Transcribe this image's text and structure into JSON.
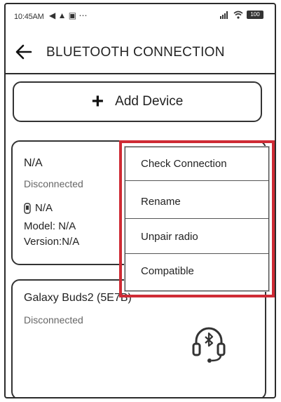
{
  "status_bar": {
    "time": "10:45AM",
    "left_icons": "◀ ▲ ▣ ⋯",
    "battery": "100"
  },
  "header": {
    "title": "BLUETOOTH CONNECTION"
  },
  "add_device": {
    "label": "Add Device"
  },
  "devices": [
    {
      "name": "N/A",
      "status": "Disconnected",
      "device": "N/A",
      "model": "Model: N/A",
      "version": "Version:N/A"
    },
    {
      "name": "Galaxy Buds2 (5E7B)",
      "status": "Disconnected"
    }
  ],
  "context_menu": {
    "items": [
      "Check Connection",
      "Rename",
      "Unpair radio",
      "Compatible"
    ]
  },
  "colors": {
    "highlight": "#cf2b35",
    "border": "#333333"
  }
}
